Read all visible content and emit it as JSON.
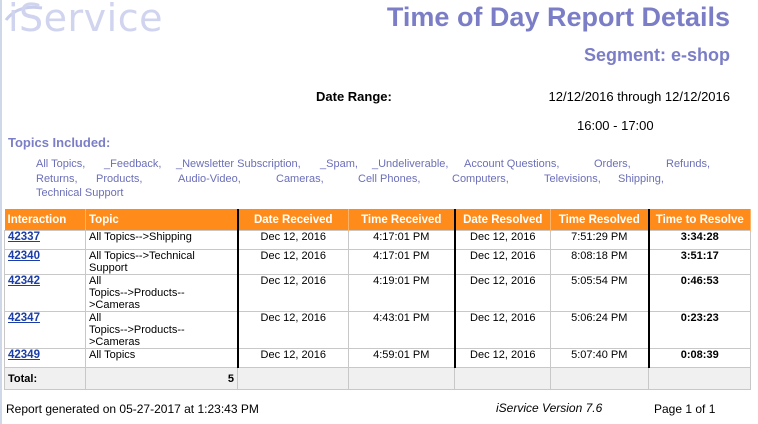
{
  "logo": "iService",
  "title": "Time of Day Report Details",
  "segment": "Segment: e-shop",
  "date_range": {
    "label": "Date Range:",
    "value": "12/12/2016 through 12/12/2016",
    "time": "16:00 - 17:00"
  },
  "topics": {
    "label": "Topics Included:",
    "items": [
      "All Topics,",
      "_Feedback,",
      "_Newsletter Subscription,",
      "_Spam,",
      "_Undeliverable,",
      "Account Questions,",
      "Orders,",
      "Refunds,",
      "Returns,",
      "Products,",
      "Audio-Video,",
      "Cameras,",
      "Cell Phones,",
      "Computers,",
      "Televisions,",
      "Shipping,",
      "Technical Support"
    ]
  },
  "table": {
    "headers": [
      "Interaction",
      "Topic",
      "Date Received",
      "Time Received",
      "Date Resolved",
      "Time Resolved",
      "Time to Resolve"
    ],
    "rows": [
      {
        "id": "42337",
        "topic": "All Topics-->Shipping",
        "date_received": "Dec 12, 2016",
        "time_received": "4:17:01 PM",
        "date_resolved": "Dec 12, 2016",
        "time_resolved": "7:51:29 PM",
        "time_to_resolve": "3:34:28"
      },
      {
        "id": "42340",
        "topic": "All Topics-->Technical Support",
        "date_received": "Dec 12, 2016",
        "time_received": "4:17:01 PM",
        "date_resolved": "Dec 12, 2016",
        "time_resolved": "8:08:18 PM",
        "time_to_resolve": "3:51:17"
      },
      {
        "id": "42342",
        "topic_line1": "All",
        "topic_line2": "Topics-->Products-->Cameras",
        "date_received": "Dec 12, 2016",
        "time_received": "4:19:01 PM",
        "date_resolved": "Dec 12, 2016",
        "time_resolved": "5:05:54 PM",
        "time_to_resolve": "0:46:53"
      },
      {
        "id": "42347",
        "topic_line1": "All",
        "topic_line2": "Topics-->Products-->Cameras",
        "date_received": "Dec 12, 2016",
        "time_received": "4:43:01 PM",
        "date_resolved": "Dec 12, 2016",
        "time_resolved": "5:06:24 PM",
        "time_to_resolve": "0:23:23"
      },
      {
        "id": "42349",
        "topic": "All Topics",
        "date_received": "Dec 12, 2016",
        "time_received": "4:59:01 PM",
        "date_resolved": "Dec 12, 2016",
        "time_resolved": "5:07:40 PM",
        "time_to_resolve": "0:08:39"
      }
    ],
    "total_label": "Total:",
    "total_count": "5"
  },
  "footer": {
    "generated": "Report generated on 05-27-2017 at 1:23:43 PM",
    "version": "iService Version 7.6",
    "page": "Page 1 of 1"
  }
}
